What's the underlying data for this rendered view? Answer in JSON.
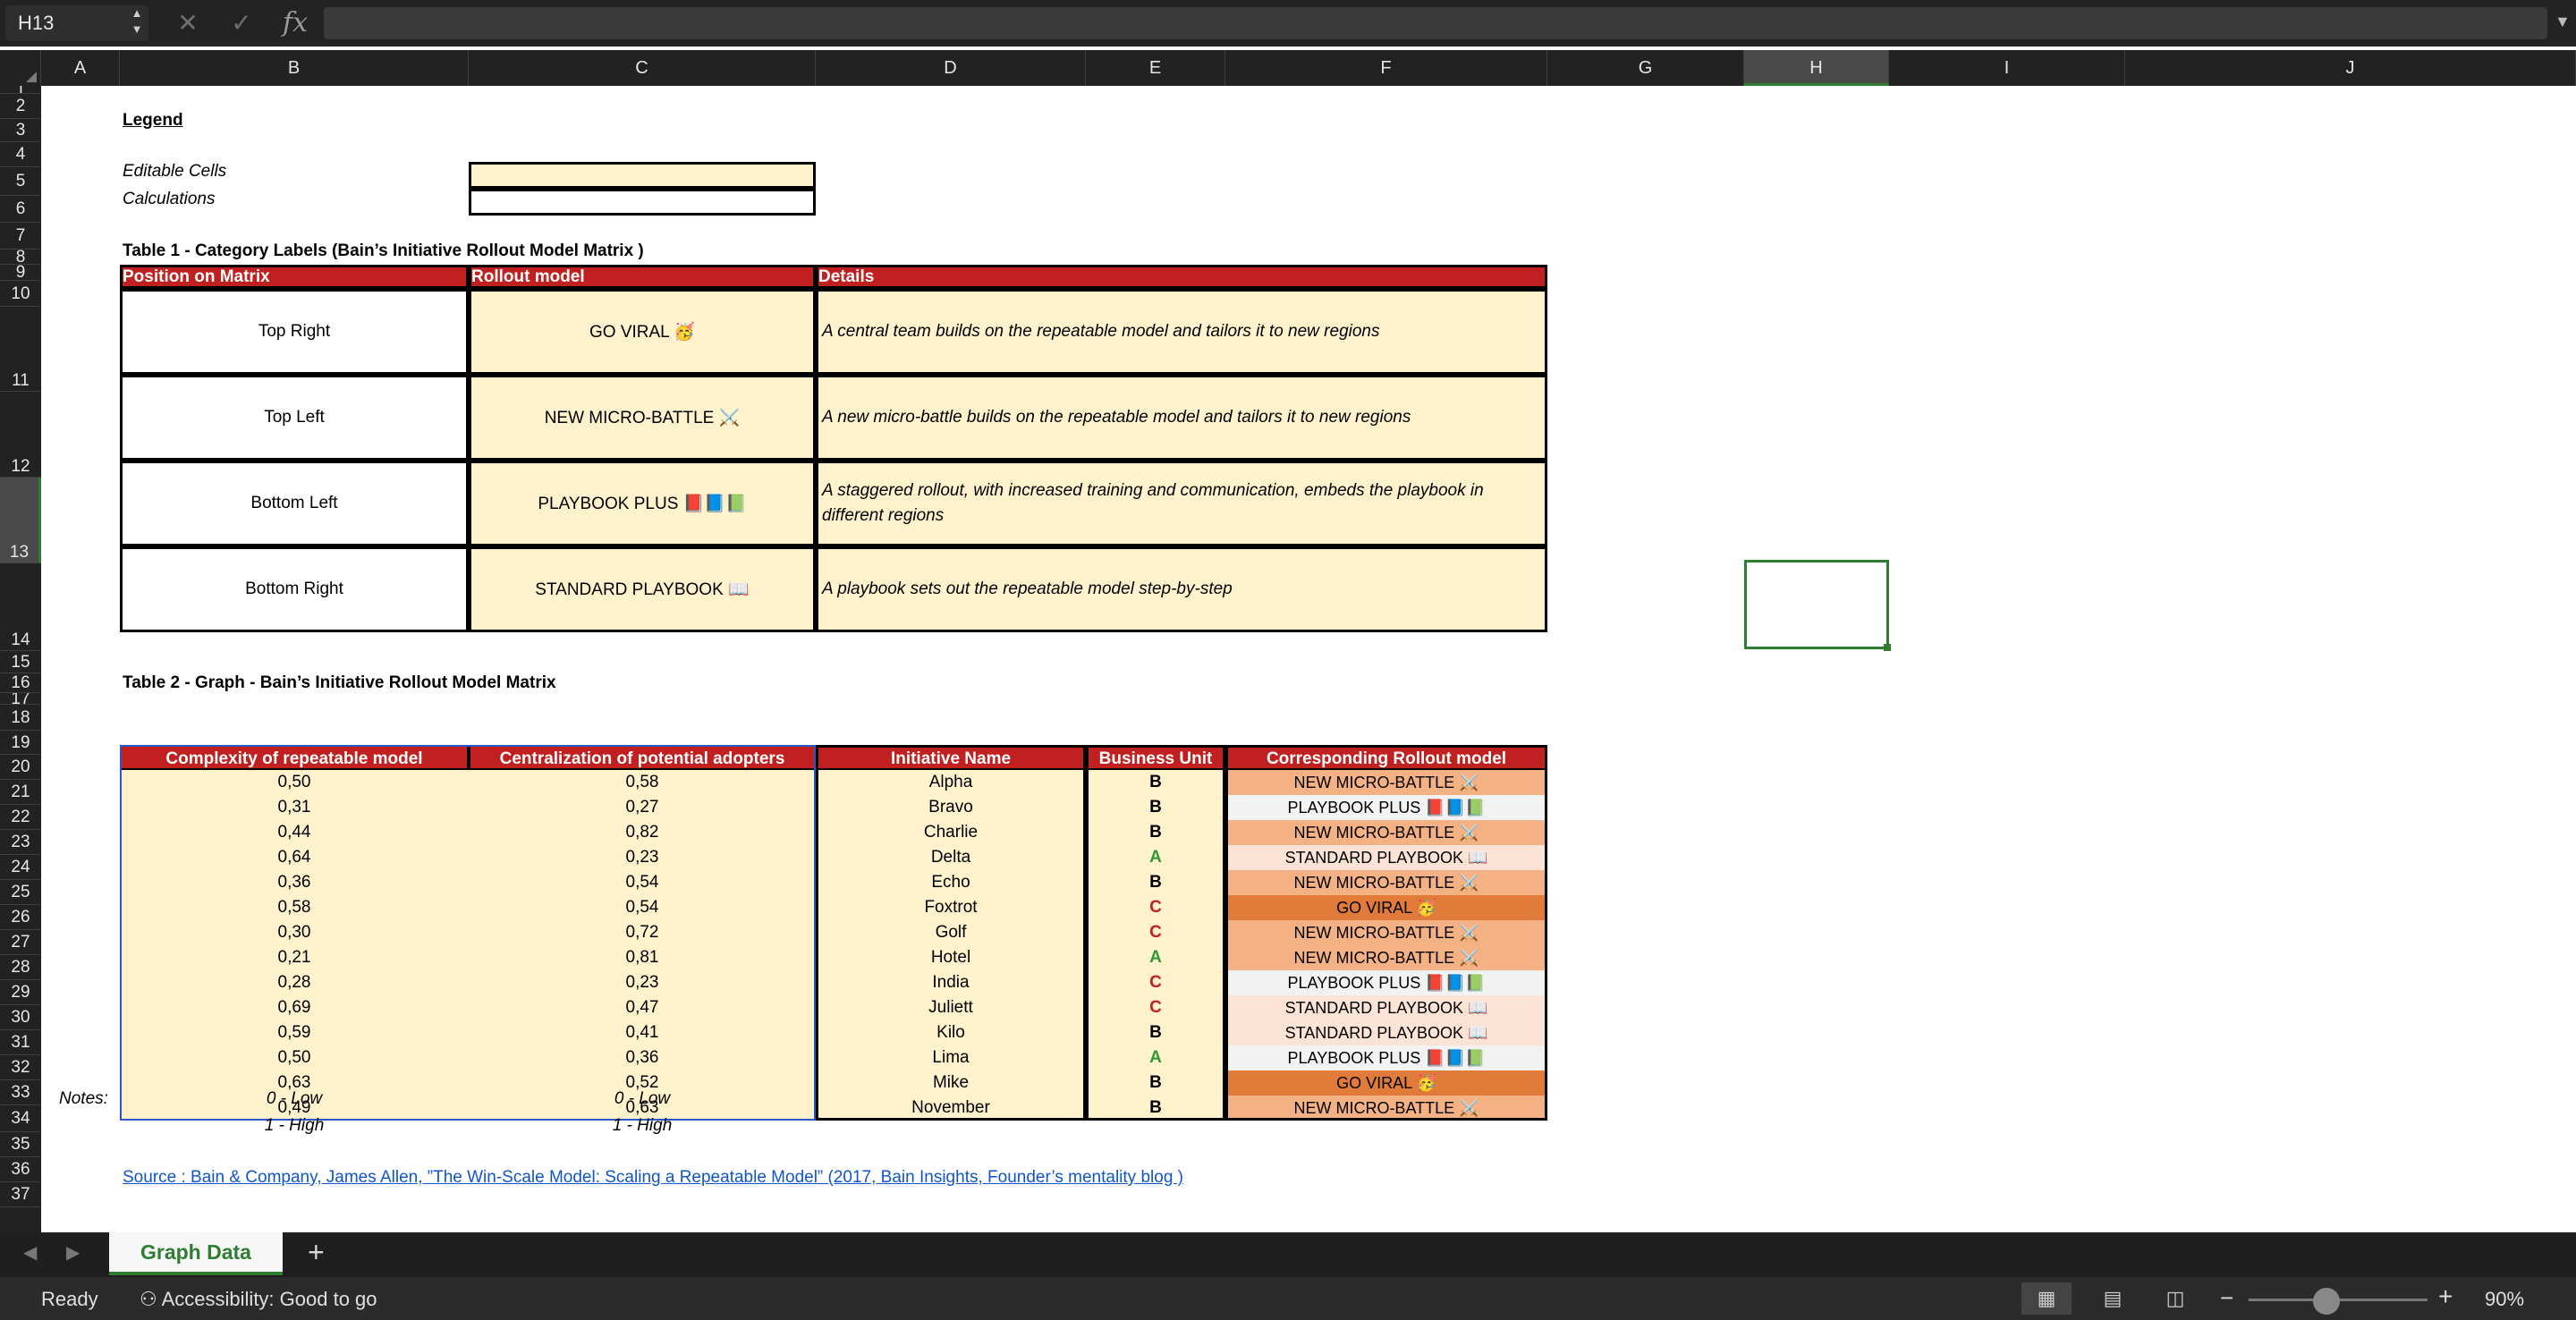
{
  "formula_bar": {
    "name_box": "H13",
    "cancel_icon": "✕",
    "confirm_icon": "✓",
    "fx_icon": "fx",
    "formula": ""
  },
  "columns": [
    "A",
    "B",
    "C",
    "D",
    "E",
    "F",
    "G",
    "H",
    "I",
    "J"
  ],
  "rows": [
    "1",
    "2",
    "3",
    "4",
    "5",
    "6",
    "7",
    "8",
    "9",
    "10",
    "11",
    "12",
    "13",
    "14",
    "15",
    "16",
    "17",
    "18",
    "19",
    "20",
    "21",
    "22",
    "23",
    "24",
    "25",
    "26",
    "27",
    "28",
    "29",
    "30",
    "31",
    "32",
    "33",
    "34",
    "35",
    "36",
    "37"
  ],
  "selected_cell": {
    "column": "H",
    "row": "13"
  },
  "legend": {
    "title": "Legend",
    "editable": "Editable Cells",
    "calculations": "Calculations"
  },
  "table1": {
    "title": "Table 1 - Category Labels (Bain’s Initiative Rollout Model Matrix )",
    "headers": [
      "Position on Matrix",
      "Rollout model",
      "Details"
    ],
    "rows": [
      {
        "position": "Top Right",
        "model": "GO VIRAL 🥳",
        "details": "A central team builds on the repeatable model and tailors it to new regions"
      },
      {
        "position": "Top Left",
        "model": "NEW MICRO-BATTLE ⚔️",
        "details": "A new micro-battle builds on the repeatable model and tailors it to new regions"
      },
      {
        "position": "Bottom Left",
        "model": "PLAYBOOK PLUS 📕📘📗",
        "details": "A staggered rollout, with increased training and communication, embeds the playbook in different regions"
      },
      {
        "position": "Bottom Right",
        "model": "STANDARD PLAYBOOK 📖",
        "details": "A playbook sets out the repeatable model step-by-step"
      }
    ]
  },
  "table2": {
    "title": "Table 2 - Graph - Bain’s Initiative Rollout Model Matrix",
    "headers": [
      "Complexity of repeatable model",
      "Centralization of potential adopters",
      "Initiative Name",
      "Business Unit",
      "Corresponding Rollout model"
    ],
    "rows": [
      {
        "complexity": "0,50",
        "centralization": "0,58",
        "name": "Alpha",
        "unit": "B",
        "model": "NEW MICRO-BATTLE ⚔️"
      },
      {
        "complexity": "0,31",
        "centralization": "0,27",
        "name": "Bravo",
        "unit": "B",
        "model": "PLAYBOOK PLUS 📕📘📗"
      },
      {
        "complexity": "0,44",
        "centralization": "0,82",
        "name": "Charlie",
        "unit": "B",
        "model": "NEW MICRO-BATTLE ⚔️"
      },
      {
        "complexity": "0,64",
        "centralization": "0,23",
        "name": "Delta",
        "unit": "A",
        "model": "STANDARD PLAYBOOK 📖"
      },
      {
        "complexity": "0,36",
        "centralization": "0,54",
        "name": "Echo",
        "unit": "B",
        "model": "NEW MICRO-BATTLE ⚔️"
      },
      {
        "complexity": "0,58",
        "centralization": "0,54",
        "name": "Foxtrot",
        "unit": "C",
        "model": "GO VIRAL 🥳"
      },
      {
        "complexity": "0,30",
        "centralization": "0,72",
        "name": "Golf",
        "unit": "C",
        "model": "NEW MICRO-BATTLE ⚔️"
      },
      {
        "complexity": "0,21",
        "centralization": "0,81",
        "name": "Hotel",
        "unit": "A",
        "model": "NEW MICRO-BATTLE ⚔️"
      },
      {
        "complexity": "0,28",
        "centralization": "0,23",
        "name": "India",
        "unit": "C",
        "model": "PLAYBOOK PLUS 📕📘📗"
      },
      {
        "complexity": "0,69",
        "centralization": "0,47",
        "name": "Juliett",
        "unit": "C",
        "model": "STANDARD PLAYBOOK 📖"
      },
      {
        "complexity": "0,59",
        "centralization": "0,41",
        "name": "Kilo",
        "unit": "B",
        "model": "STANDARD PLAYBOOK 📖"
      },
      {
        "complexity": "0,50",
        "centralization": "0,36",
        "name": "Lima",
        "unit": "A",
        "model": "PLAYBOOK PLUS 📕📘📗"
      },
      {
        "complexity": "0,63",
        "centralization": "0,52",
        "name": "Mike",
        "unit": "B",
        "model": "GO VIRAL 🥳"
      },
      {
        "complexity": "0,49",
        "centralization": "0,63",
        "name": "November",
        "unit": "B",
        "model": "NEW MICRO-BATTLE ⚔️"
      }
    ]
  },
  "notes": {
    "label": "Notes:",
    "low": "0 - Low",
    "high": "1 - High"
  },
  "source": "Source : Bain & Company, James Allen, ”The Win-Scale Model: Scaling a Repeatable Model” (2017, Bain Insights, Founder’s mentality blog )",
  "sheet_tabs": [
    {
      "label": "Graph Data",
      "active": true
    }
  ],
  "status_bar": {
    "ready": "Ready",
    "accessibility": "Accessibility: Good to go",
    "zoom": "90%"
  },
  "colors": {
    "header_red": "#c0201f",
    "cream": "#fff2cc",
    "unit_a": "#2e9b2e",
    "unit_b": "#000000",
    "unit_c": "#c0201f",
    "model_new_micro_battle": "#f4b183",
    "model_playbook_plus": "#f2f2f2",
    "model_standard_playbook": "#fbe4d5",
    "model_go_viral": "#e07b39",
    "selection_green": "#2e7d32"
  }
}
